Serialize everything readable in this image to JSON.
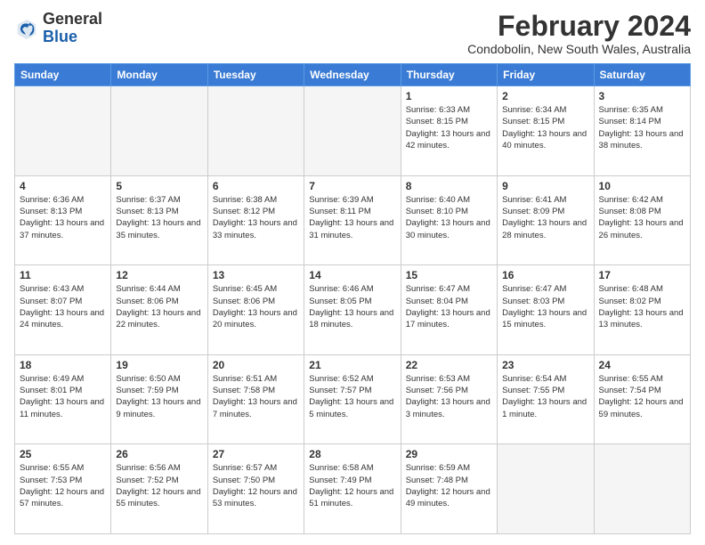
{
  "logo": {
    "general": "General",
    "blue": "Blue"
  },
  "title": "February 2024",
  "subtitle": "Condobolin, New South Wales, Australia",
  "days_header": [
    "Sunday",
    "Monday",
    "Tuesday",
    "Wednesday",
    "Thursday",
    "Friday",
    "Saturday"
  ],
  "weeks": [
    [
      {
        "day": "",
        "sunrise": "",
        "sunset": "",
        "daylight": ""
      },
      {
        "day": "",
        "sunrise": "",
        "sunset": "",
        "daylight": ""
      },
      {
        "day": "",
        "sunrise": "",
        "sunset": "",
        "daylight": ""
      },
      {
        "day": "",
        "sunrise": "",
        "sunset": "",
        "daylight": ""
      },
      {
        "day": "1",
        "sunrise": "Sunrise: 6:33 AM",
        "sunset": "Sunset: 8:15 PM",
        "daylight": "Daylight: 13 hours and 42 minutes."
      },
      {
        "day": "2",
        "sunrise": "Sunrise: 6:34 AM",
        "sunset": "Sunset: 8:15 PM",
        "daylight": "Daylight: 13 hours and 40 minutes."
      },
      {
        "day": "3",
        "sunrise": "Sunrise: 6:35 AM",
        "sunset": "Sunset: 8:14 PM",
        "daylight": "Daylight: 13 hours and 38 minutes."
      }
    ],
    [
      {
        "day": "4",
        "sunrise": "Sunrise: 6:36 AM",
        "sunset": "Sunset: 8:13 PM",
        "daylight": "Daylight: 13 hours and 37 minutes."
      },
      {
        "day": "5",
        "sunrise": "Sunrise: 6:37 AM",
        "sunset": "Sunset: 8:13 PM",
        "daylight": "Daylight: 13 hours and 35 minutes."
      },
      {
        "day": "6",
        "sunrise": "Sunrise: 6:38 AM",
        "sunset": "Sunset: 8:12 PM",
        "daylight": "Daylight: 13 hours and 33 minutes."
      },
      {
        "day": "7",
        "sunrise": "Sunrise: 6:39 AM",
        "sunset": "Sunset: 8:11 PM",
        "daylight": "Daylight: 13 hours and 31 minutes."
      },
      {
        "day": "8",
        "sunrise": "Sunrise: 6:40 AM",
        "sunset": "Sunset: 8:10 PM",
        "daylight": "Daylight: 13 hours and 30 minutes."
      },
      {
        "day": "9",
        "sunrise": "Sunrise: 6:41 AM",
        "sunset": "Sunset: 8:09 PM",
        "daylight": "Daylight: 13 hours and 28 minutes."
      },
      {
        "day": "10",
        "sunrise": "Sunrise: 6:42 AM",
        "sunset": "Sunset: 8:08 PM",
        "daylight": "Daylight: 13 hours and 26 minutes."
      }
    ],
    [
      {
        "day": "11",
        "sunrise": "Sunrise: 6:43 AM",
        "sunset": "Sunset: 8:07 PM",
        "daylight": "Daylight: 13 hours and 24 minutes."
      },
      {
        "day": "12",
        "sunrise": "Sunrise: 6:44 AM",
        "sunset": "Sunset: 8:06 PM",
        "daylight": "Daylight: 13 hours and 22 minutes."
      },
      {
        "day": "13",
        "sunrise": "Sunrise: 6:45 AM",
        "sunset": "Sunset: 8:06 PM",
        "daylight": "Daylight: 13 hours and 20 minutes."
      },
      {
        "day": "14",
        "sunrise": "Sunrise: 6:46 AM",
        "sunset": "Sunset: 8:05 PM",
        "daylight": "Daylight: 13 hours and 18 minutes."
      },
      {
        "day": "15",
        "sunrise": "Sunrise: 6:47 AM",
        "sunset": "Sunset: 8:04 PM",
        "daylight": "Daylight: 13 hours and 17 minutes."
      },
      {
        "day": "16",
        "sunrise": "Sunrise: 6:47 AM",
        "sunset": "Sunset: 8:03 PM",
        "daylight": "Daylight: 13 hours and 15 minutes."
      },
      {
        "day": "17",
        "sunrise": "Sunrise: 6:48 AM",
        "sunset": "Sunset: 8:02 PM",
        "daylight": "Daylight: 13 hours and 13 minutes."
      }
    ],
    [
      {
        "day": "18",
        "sunrise": "Sunrise: 6:49 AM",
        "sunset": "Sunset: 8:01 PM",
        "daylight": "Daylight: 13 hours and 11 minutes."
      },
      {
        "day": "19",
        "sunrise": "Sunrise: 6:50 AM",
        "sunset": "Sunset: 7:59 PM",
        "daylight": "Daylight: 13 hours and 9 minutes."
      },
      {
        "day": "20",
        "sunrise": "Sunrise: 6:51 AM",
        "sunset": "Sunset: 7:58 PM",
        "daylight": "Daylight: 13 hours and 7 minutes."
      },
      {
        "day": "21",
        "sunrise": "Sunrise: 6:52 AM",
        "sunset": "Sunset: 7:57 PM",
        "daylight": "Daylight: 13 hours and 5 minutes."
      },
      {
        "day": "22",
        "sunrise": "Sunrise: 6:53 AM",
        "sunset": "Sunset: 7:56 PM",
        "daylight": "Daylight: 13 hours and 3 minutes."
      },
      {
        "day": "23",
        "sunrise": "Sunrise: 6:54 AM",
        "sunset": "Sunset: 7:55 PM",
        "daylight": "Daylight: 13 hours and 1 minute."
      },
      {
        "day": "24",
        "sunrise": "Sunrise: 6:55 AM",
        "sunset": "Sunset: 7:54 PM",
        "daylight": "Daylight: 12 hours and 59 minutes."
      }
    ],
    [
      {
        "day": "25",
        "sunrise": "Sunrise: 6:55 AM",
        "sunset": "Sunset: 7:53 PM",
        "daylight": "Daylight: 12 hours and 57 minutes."
      },
      {
        "day": "26",
        "sunrise": "Sunrise: 6:56 AM",
        "sunset": "Sunset: 7:52 PM",
        "daylight": "Daylight: 12 hours and 55 minutes."
      },
      {
        "day": "27",
        "sunrise": "Sunrise: 6:57 AM",
        "sunset": "Sunset: 7:50 PM",
        "daylight": "Daylight: 12 hours and 53 minutes."
      },
      {
        "day": "28",
        "sunrise": "Sunrise: 6:58 AM",
        "sunset": "Sunset: 7:49 PM",
        "daylight": "Daylight: 12 hours and 51 minutes."
      },
      {
        "day": "29",
        "sunrise": "Sunrise: 6:59 AM",
        "sunset": "Sunset: 7:48 PM",
        "daylight": "Daylight: 12 hours and 49 minutes."
      },
      {
        "day": "",
        "sunrise": "",
        "sunset": "",
        "daylight": ""
      },
      {
        "day": "",
        "sunrise": "",
        "sunset": "",
        "daylight": ""
      }
    ]
  ]
}
